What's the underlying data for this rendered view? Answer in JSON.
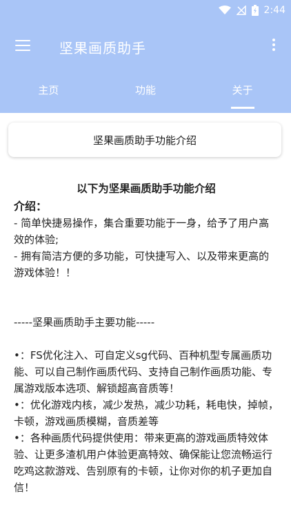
{
  "status": {
    "time": "2:44"
  },
  "appbar": {
    "title": "坚果画质助手"
  },
  "tabs": [
    {
      "label": "主页"
    },
    {
      "label": "功能"
    },
    {
      "label": "关于"
    }
  ],
  "card": {
    "label": "坚果画质助手功能介绍"
  },
  "content": {
    "headline": "以下为坚果画质助手功能介绍",
    "intro_label": "介绍：",
    "intro_lines": [
      "- 简单快捷易操作，集合重要功能于一身，给予了用户高效的体验;",
      "- 拥有简洁方便的多功能，可快捷写入、以及带来更高的游戏体验！！"
    ],
    "section_title": "-----坚果画质助手主要功能-----",
    "features": [
      "•：FS优化注入、可自定义sg代码、百种机型专属画质功能、可以自己制作画质代码、支持自己制作画质功能、专属游戏版本选项、解锁超高音质等！",
      "•：优化游戏内核，减少发热，减少功耗，耗电快，掉帧，卡顿，游戏画质模糊，音质差等",
      "•：各种画质代码提供使用：带来更高的游戏画质特效体验、让更多渣机用户体验更高特效、确保能让您流畅运行吃鸡这款游戏、告别原有的卡顿，让你对你的机子更加自信！"
    ]
  }
}
